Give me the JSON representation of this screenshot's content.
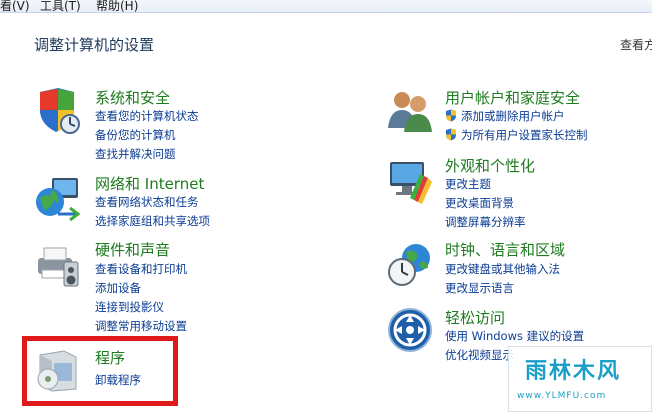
{
  "menu": {
    "view": "看(V)",
    "tools": "工具(T)",
    "help": "帮助(H)"
  },
  "header": {
    "title": "调整计算机的设置",
    "view_by": "查看方"
  },
  "categories": {
    "system": {
      "title": "系统和安全",
      "links": [
        "查看您的计算机状态",
        "备份您的计算机",
        "查找并解决问题"
      ]
    },
    "network": {
      "title": "网络和 Internet",
      "links": [
        "查看网络状态和任务",
        "选择家庭组和共享选项"
      ]
    },
    "hardware": {
      "title": "硬件和声音",
      "links": [
        "查看设备和打印机",
        "添加设备",
        "连接到投影仪",
        "调整常用移动设置"
      ]
    },
    "programs": {
      "title": "程序",
      "links": [
        "卸载程序"
      ]
    },
    "users": {
      "title": "用户帐户和家庭安全",
      "links": [
        "添加或删除用户帐户",
        "为所有用户设置家长控制"
      ]
    },
    "appearance": {
      "title": "外观和个性化",
      "links": [
        "更改主题",
        "更改桌面背景",
        "调整屏幕分辨率"
      ]
    },
    "clock": {
      "title": "时钟、语言和区域",
      "links": [
        "更改键盘或其他输入法",
        "更改显示语言"
      ]
    },
    "ease": {
      "title": "轻松访问",
      "links": [
        "使用 Windows 建议的设置",
        "优化视频显示"
      ]
    }
  },
  "watermark": {
    "brand": "雨林木风",
    "url": "www.YLMFU.com"
  },
  "colors": {
    "title_green": "#1e7b1e",
    "link_blue": "#0b3c93",
    "highlight_red": "#e01a1a"
  }
}
